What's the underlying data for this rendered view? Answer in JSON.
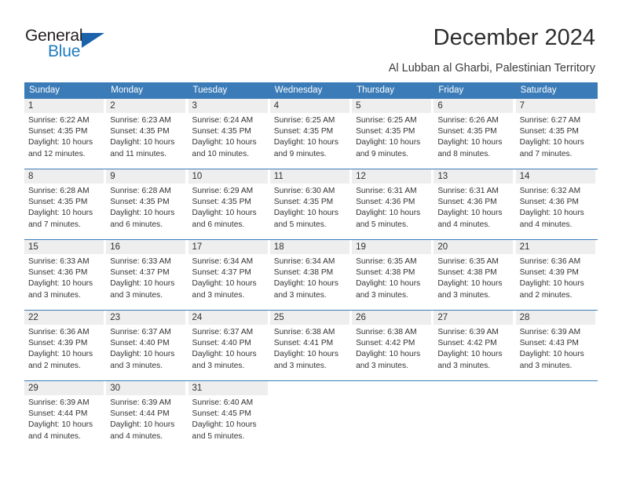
{
  "brand": {
    "name_part1": "General",
    "name_part2": "Blue",
    "logo_icon": "triangle-logo-icon",
    "accent_color": "#1b62ac"
  },
  "header": {
    "title": "December 2024",
    "subtitle": "Al Lubban al Gharbi, Palestinian Territory"
  },
  "colors": {
    "header_row_background": "#3b7cb8",
    "daynum_band_background": "#eeeeee",
    "week_separator": "#3b7cb8",
    "text": "#333333"
  },
  "calendar": {
    "weekdays": [
      "Sunday",
      "Monday",
      "Tuesday",
      "Wednesday",
      "Thursday",
      "Friday",
      "Saturday"
    ],
    "weeks": [
      [
        {
          "day": "1",
          "sunrise": "Sunrise: 6:22 AM",
          "sunset": "Sunset: 4:35 PM",
          "daylight": "Daylight: 10 hours and 12 minutes."
        },
        {
          "day": "2",
          "sunrise": "Sunrise: 6:23 AM",
          "sunset": "Sunset: 4:35 PM",
          "daylight": "Daylight: 10 hours and 11 minutes."
        },
        {
          "day": "3",
          "sunrise": "Sunrise: 6:24 AM",
          "sunset": "Sunset: 4:35 PM",
          "daylight": "Daylight: 10 hours and 10 minutes."
        },
        {
          "day": "4",
          "sunrise": "Sunrise: 6:25 AM",
          "sunset": "Sunset: 4:35 PM",
          "daylight": "Daylight: 10 hours and 9 minutes."
        },
        {
          "day": "5",
          "sunrise": "Sunrise: 6:25 AM",
          "sunset": "Sunset: 4:35 PM",
          "daylight": "Daylight: 10 hours and 9 minutes."
        },
        {
          "day": "6",
          "sunrise": "Sunrise: 6:26 AM",
          "sunset": "Sunset: 4:35 PM",
          "daylight": "Daylight: 10 hours and 8 minutes."
        },
        {
          "day": "7",
          "sunrise": "Sunrise: 6:27 AM",
          "sunset": "Sunset: 4:35 PM",
          "daylight": "Daylight: 10 hours and 7 minutes."
        }
      ],
      [
        {
          "day": "8",
          "sunrise": "Sunrise: 6:28 AM",
          "sunset": "Sunset: 4:35 PM",
          "daylight": "Daylight: 10 hours and 7 minutes."
        },
        {
          "day": "9",
          "sunrise": "Sunrise: 6:28 AM",
          "sunset": "Sunset: 4:35 PM",
          "daylight": "Daylight: 10 hours and 6 minutes."
        },
        {
          "day": "10",
          "sunrise": "Sunrise: 6:29 AM",
          "sunset": "Sunset: 4:35 PM",
          "daylight": "Daylight: 10 hours and 6 minutes."
        },
        {
          "day": "11",
          "sunrise": "Sunrise: 6:30 AM",
          "sunset": "Sunset: 4:35 PM",
          "daylight": "Daylight: 10 hours and 5 minutes."
        },
        {
          "day": "12",
          "sunrise": "Sunrise: 6:31 AM",
          "sunset": "Sunset: 4:36 PM",
          "daylight": "Daylight: 10 hours and 5 minutes."
        },
        {
          "day": "13",
          "sunrise": "Sunrise: 6:31 AM",
          "sunset": "Sunset: 4:36 PM",
          "daylight": "Daylight: 10 hours and 4 minutes."
        },
        {
          "day": "14",
          "sunrise": "Sunrise: 6:32 AM",
          "sunset": "Sunset: 4:36 PM",
          "daylight": "Daylight: 10 hours and 4 minutes."
        }
      ],
      [
        {
          "day": "15",
          "sunrise": "Sunrise: 6:33 AM",
          "sunset": "Sunset: 4:36 PM",
          "daylight": "Daylight: 10 hours and 3 minutes."
        },
        {
          "day": "16",
          "sunrise": "Sunrise: 6:33 AM",
          "sunset": "Sunset: 4:37 PM",
          "daylight": "Daylight: 10 hours and 3 minutes."
        },
        {
          "day": "17",
          "sunrise": "Sunrise: 6:34 AM",
          "sunset": "Sunset: 4:37 PM",
          "daylight": "Daylight: 10 hours and 3 minutes."
        },
        {
          "day": "18",
          "sunrise": "Sunrise: 6:34 AM",
          "sunset": "Sunset: 4:38 PM",
          "daylight": "Daylight: 10 hours and 3 minutes."
        },
        {
          "day": "19",
          "sunrise": "Sunrise: 6:35 AM",
          "sunset": "Sunset: 4:38 PM",
          "daylight": "Daylight: 10 hours and 3 minutes."
        },
        {
          "day": "20",
          "sunrise": "Sunrise: 6:35 AM",
          "sunset": "Sunset: 4:38 PM",
          "daylight": "Daylight: 10 hours and 3 minutes."
        },
        {
          "day": "21",
          "sunrise": "Sunrise: 6:36 AM",
          "sunset": "Sunset: 4:39 PM",
          "daylight": "Daylight: 10 hours and 2 minutes."
        }
      ],
      [
        {
          "day": "22",
          "sunrise": "Sunrise: 6:36 AM",
          "sunset": "Sunset: 4:39 PM",
          "daylight": "Daylight: 10 hours and 2 minutes."
        },
        {
          "day": "23",
          "sunrise": "Sunrise: 6:37 AM",
          "sunset": "Sunset: 4:40 PM",
          "daylight": "Daylight: 10 hours and 3 minutes."
        },
        {
          "day": "24",
          "sunrise": "Sunrise: 6:37 AM",
          "sunset": "Sunset: 4:40 PM",
          "daylight": "Daylight: 10 hours and 3 minutes."
        },
        {
          "day": "25",
          "sunrise": "Sunrise: 6:38 AM",
          "sunset": "Sunset: 4:41 PM",
          "daylight": "Daylight: 10 hours and 3 minutes."
        },
        {
          "day": "26",
          "sunrise": "Sunrise: 6:38 AM",
          "sunset": "Sunset: 4:42 PM",
          "daylight": "Daylight: 10 hours and 3 minutes."
        },
        {
          "day": "27",
          "sunrise": "Sunrise: 6:39 AM",
          "sunset": "Sunset: 4:42 PM",
          "daylight": "Daylight: 10 hours and 3 minutes."
        },
        {
          "day": "28",
          "sunrise": "Sunrise: 6:39 AM",
          "sunset": "Sunset: 4:43 PM",
          "daylight": "Daylight: 10 hours and 3 minutes."
        }
      ],
      [
        {
          "day": "29",
          "sunrise": "Sunrise: 6:39 AM",
          "sunset": "Sunset: 4:44 PM",
          "daylight": "Daylight: 10 hours and 4 minutes."
        },
        {
          "day": "30",
          "sunrise": "Sunrise: 6:39 AM",
          "sunset": "Sunset: 4:44 PM",
          "daylight": "Daylight: 10 hours and 4 minutes."
        },
        {
          "day": "31",
          "sunrise": "Sunrise: 6:40 AM",
          "sunset": "Sunset: 4:45 PM",
          "daylight": "Daylight: 10 hours and 5 minutes."
        },
        {
          "day": "",
          "sunrise": "",
          "sunset": "",
          "daylight": ""
        },
        {
          "day": "",
          "sunrise": "",
          "sunset": "",
          "daylight": ""
        },
        {
          "day": "",
          "sunrise": "",
          "sunset": "",
          "daylight": ""
        },
        {
          "day": "",
          "sunrise": "",
          "sunset": "",
          "daylight": ""
        }
      ]
    ]
  }
}
